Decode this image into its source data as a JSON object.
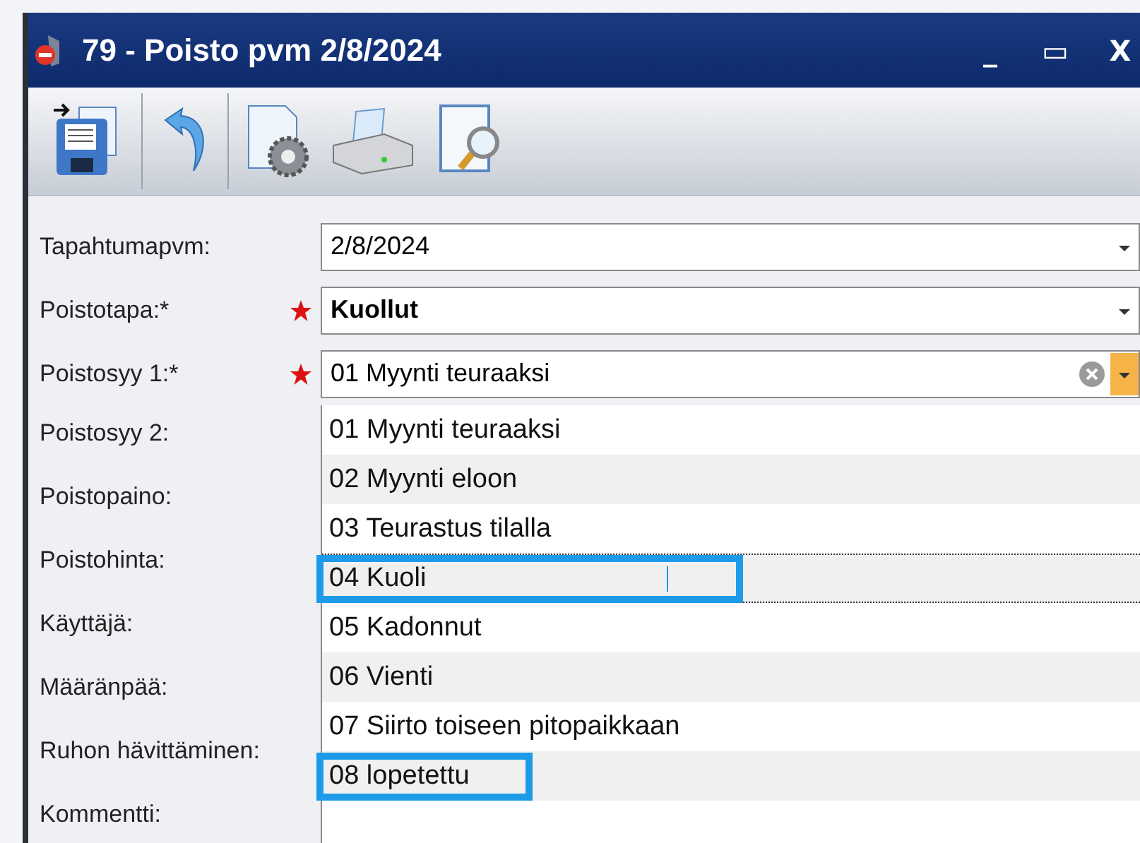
{
  "window": {
    "title": "79 - Poisto pvm 2/8/2024",
    "controls": [
      "_",
      "▭",
      "X"
    ]
  },
  "fields": [
    {
      "label": "Tapahtumapvm:",
      "required": false,
      "value": "2/8/2024",
      "bold": false,
      "clearable": false
    },
    {
      "label": "Poistotapa:*",
      "required": true,
      "value": "Kuollut",
      "bold": true,
      "clearable": false
    },
    {
      "label": "Poistosyy 1:*",
      "required": true,
      "value": "01 Myynti teuraaksi",
      "bold": false,
      "clearable": true
    }
  ],
  "other_labels": [
    "Poistosyy 2:",
    "Poistopaino:",
    "Poistohinta:",
    "Käyttäjä:",
    "Määränpää:",
    "Ruhon hävittäminen:",
    "Kommentti:"
  ],
  "dropdown": [
    {
      "label": "01 Myynti teuraaksi",
      "focused": false,
      "highlighted": false
    },
    {
      "label": "02 Myynti eloon",
      "focused": false,
      "highlighted": false
    },
    {
      "label": "03 Teurastus tilalla",
      "focused": false,
      "highlighted": false
    },
    {
      "label": "04 Kuoli",
      "focused": true,
      "highlighted": true
    },
    {
      "label": "05 Kadonnut",
      "focused": false,
      "highlighted": false
    },
    {
      "label": "06 Vienti",
      "focused": false,
      "highlighted": false
    },
    {
      "label": "07 Siirto toiseen pitopaikkaan",
      "focused": false,
      "highlighted": false
    },
    {
      "label": "08 lopetettu",
      "focused": false,
      "highlighted": true
    }
  ]
}
